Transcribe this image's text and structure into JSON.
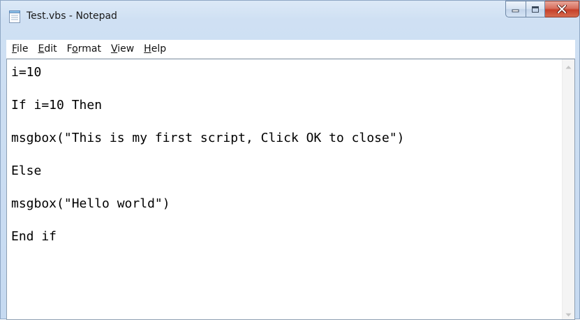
{
  "window": {
    "title": "Test.vbs - Notepad",
    "close_color": "#c6402a"
  },
  "controls": {
    "minimize_icon": "minimize-icon",
    "maximize_icon": "maximize-icon",
    "close_icon": "close-icon"
  },
  "menu": {
    "items": [
      {
        "accel": "F",
        "rest": "ile"
      },
      {
        "accel": "E",
        "rest": "dit"
      },
      {
        "prefix": "F",
        "accel": "o",
        "rest": "rmat"
      },
      {
        "accel": "V",
        "rest": "iew"
      },
      {
        "accel": "H",
        "rest": "elp"
      }
    ]
  },
  "editor": {
    "lines": [
      "i=10",
      "If i=10 Then",
      "msgbox(\"This is my first script, Click OK to close\")",
      "Else",
      "msgbox(\"Hello world\")",
      "End if"
    ]
  }
}
